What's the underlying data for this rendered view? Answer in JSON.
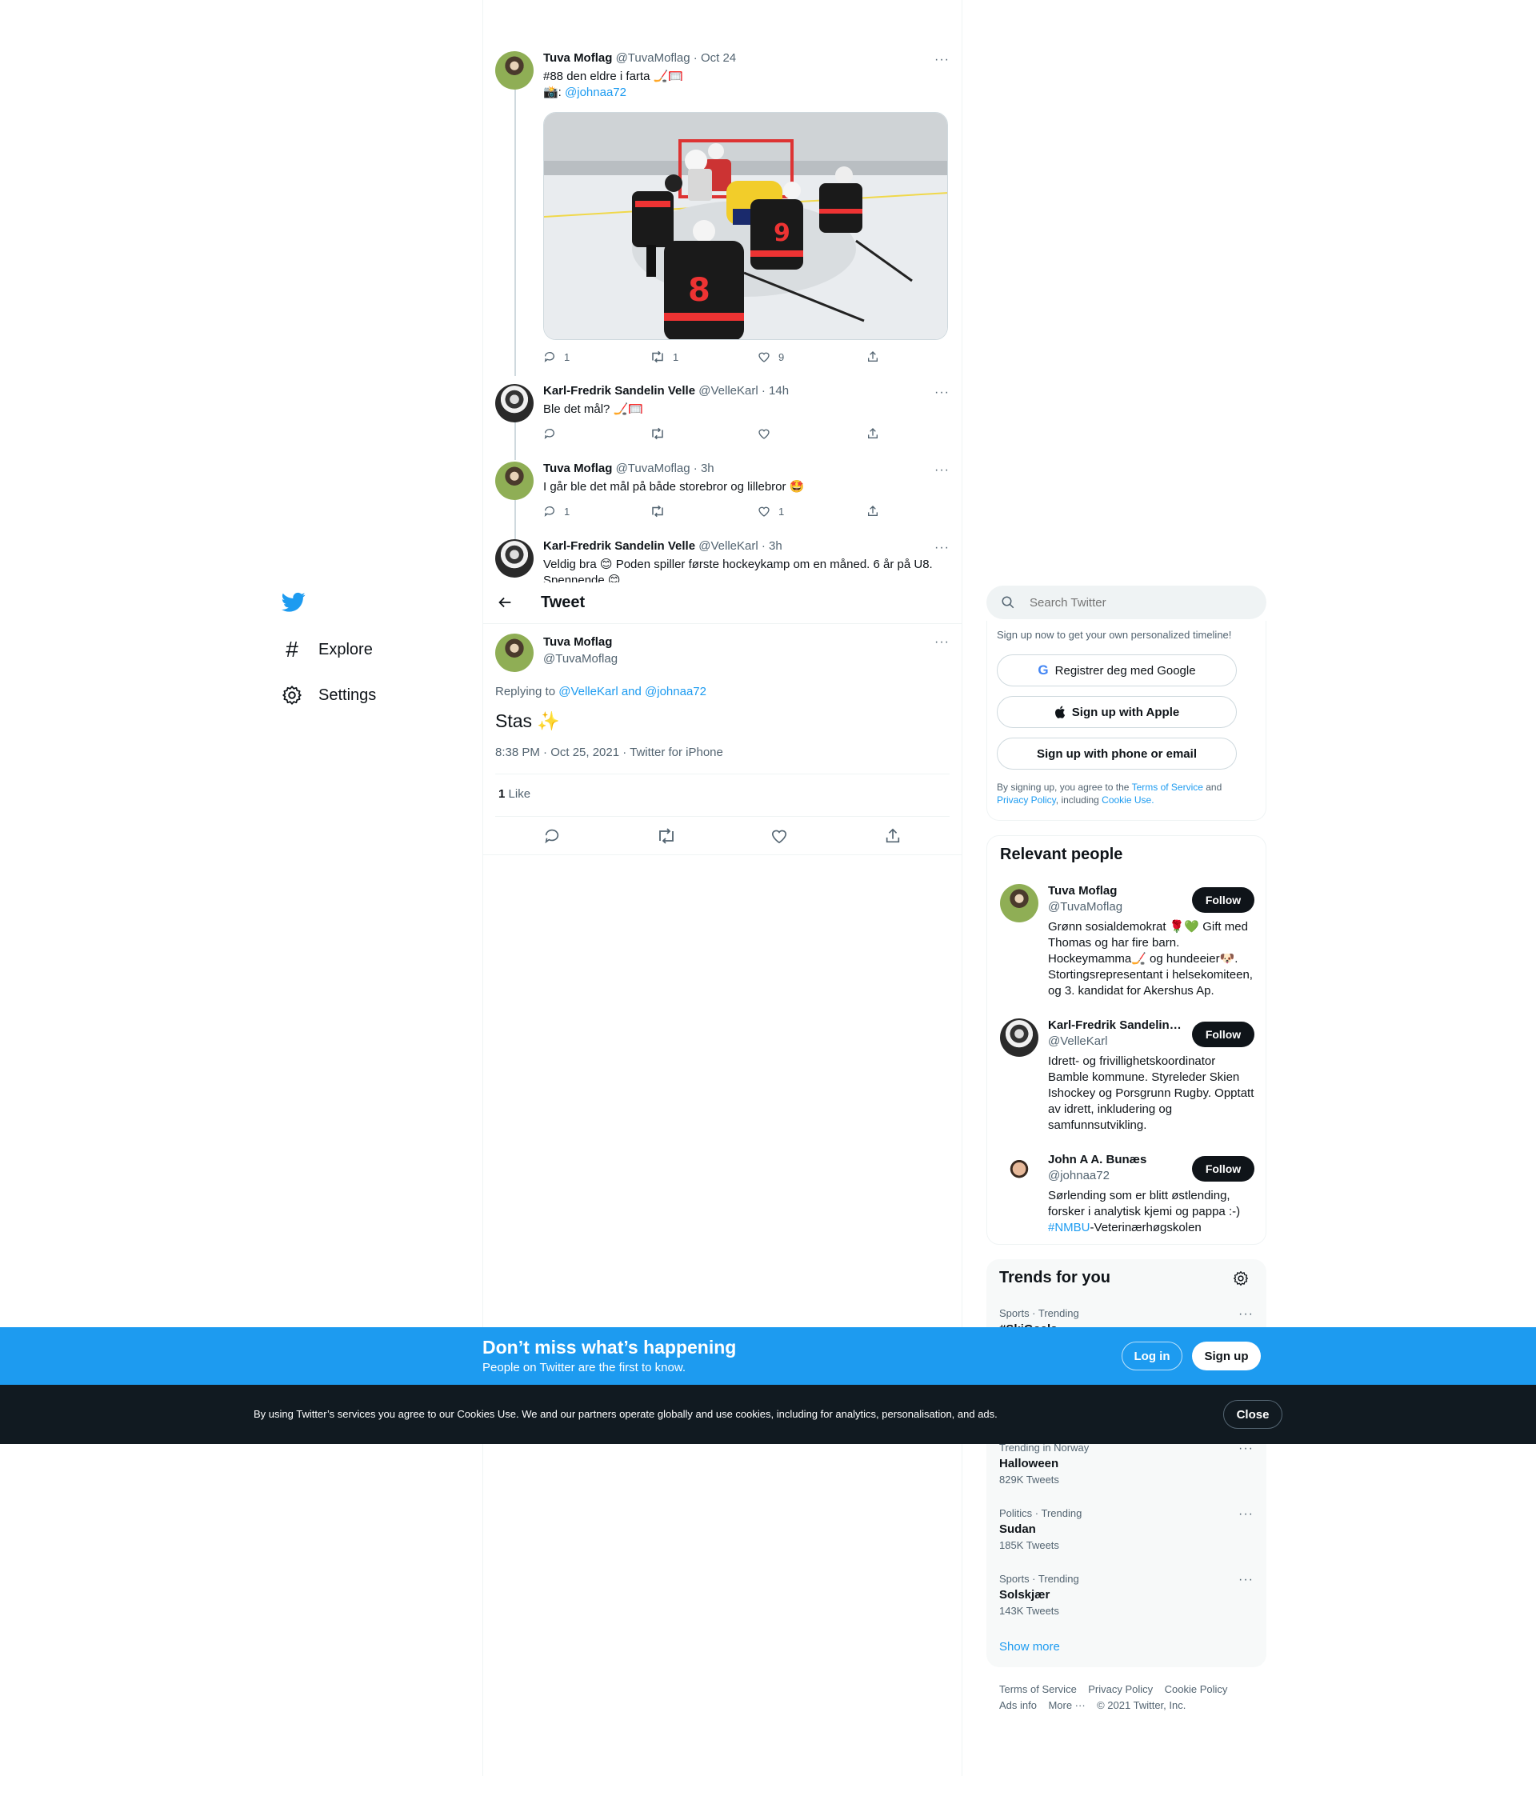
{
  "nav": {
    "explore": "Explore",
    "settings": "Settings"
  },
  "thread": [
    {
      "name": "Tuva Moflag",
      "handle": "@TuvaMoflag",
      "time": "· Oct 24",
      "line1": "#88 den eldre i farta 🏒🥅",
      "line2_prefix": "📸: ",
      "line2_link": "@johnaa72",
      "replies": "1",
      "retweets": "1",
      "likes": "9"
    },
    {
      "name": "Karl-Fredrik Sandelin Velle",
      "handle": "@VelleKarl",
      "time": "· 14h",
      "text": "Ble det mål? 🏒🥅"
    },
    {
      "name": "Tuva Moflag",
      "handle": "@TuvaMoflag",
      "time": "· 3h",
      "text": "I går ble det mål på både storebror og lillebror 🤩",
      "replies": "1",
      "likes": "1"
    },
    {
      "name": "Karl-Fredrik Sandelin Velle",
      "handle": "@VelleKarl",
      "time": "· 3h",
      "text": "Veldig bra 😊 Poden spiller første hockeykamp om en måned. 6 år på U8.",
      "text2": "Spennende 😊"
    }
  ],
  "header": {
    "title": "Tweet"
  },
  "main_tweet": {
    "name": "Tuva Moflag",
    "handle": "@TuvaMoflag",
    "replying_prefix": "Replying to ",
    "replying_to": "@VelleKarl and @johnaa72",
    "text": "Stas ✨",
    "meta": "8:38 PM · Oct 25, 2021 · Twitter for iPhone",
    "like_count": "1",
    "like_label": "Like"
  },
  "search": {
    "placeholder": "Search Twitter"
  },
  "signup": {
    "intro": "Sign up now to get your own personalized timeline!",
    "google": "Registrer deg med Google",
    "apple": "Sign up with Apple",
    "phone": "Sign up with phone or email",
    "legal_prefix": "By signing up, you agree to the ",
    "terms": "Terms of Service",
    "and": " and",
    "privacy": "Privacy Policy",
    "including": ", including ",
    "cookie": "Cookie Use."
  },
  "relevant": {
    "title": "Relevant people",
    "follow": "Follow",
    "people": [
      {
        "name": "Tuva Moflag",
        "handle": "@TuvaMoflag",
        "bio": "Grønn sosialdemokrat 🌹💚 Gift med Thomas og har fire barn. Hockeymamma🏒 og hundeeier🐶. Stortingsrepresentant i helsekomiteen, og 3. kandidat for Akershus Ap."
      },
      {
        "name": "Karl-Fredrik Sandelin Velle",
        "handle": "@VelleKarl",
        "bio": "Idrett- og frivillighetskoordinator Bamble kommune. Styreleder Skien Ishockey og Porsgrunn Rugby. Opptatt av idrett, inkludering og samfunnsutvikling."
      },
      {
        "name": "John A A. Bunæs",
        "handle": "@johnaa72",
        "bio_prefix": "Sørlending som er blitt østlending, forsker i analytisk kjemi og pappa :-) ",
        "bio_link": "#NMBU",
        "bio_suffix": "-Veterinærhøgskolen"
      }
    ]
  },
  "trends": {
    "title": "Trends for you",
    "items": [
      {
        "context": "Sports · Trending",
        "name": "#SkiGoals",
        "count": ""
      },
      {
        "context": "Trending in Norway",
        "name": "Halloween",
        "count": "829K Tweets"
      },
      {
        "context": "Politics · Trending",
        "name": "Sudan",
        "count": "185K Tweets"
      },
      {
        "context": "Sports · Trending",
        "name": "Solskjær",
        "count": "143K Tweets"
      }
    ],
    "show_more": "Show more"
  },
  "footer": {
    "terms": "Terms of Service",
    "privacy": "Privacy Policy",
    "cookie": "Cookie Policy",
    "ads": "Ads info",
    "more": "More ···",
    "copyright": "© 2021 Twitter, Inc."
  },
  "banner": {
    "title": "Don’t miss what’s happening",
    "subtitle": "People on Twitter are the first to know.",
    "login": "Log in",
    "signup": "Sign up"
  },
  "cookie_bar": {
    "text": "By using Twitter’s services you agree to our Cookies Use. We and our partners operate globally and use cookies, including for analytics, personalisation, and ads.",
    "close": "Close"
  },
  "colors": {
    "accent": "#1d9bf0",
    "dark": "#0f1419",
    "muted": "#536471",
    "banner": "#1d9bf0"
  }
}
